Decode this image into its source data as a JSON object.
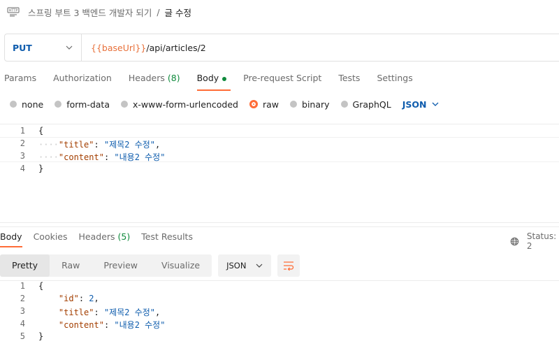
{
  "breadcrumb": {
    "path": "스프링 부트 3 백엔드 개발자 되기",
    "separator": "/",
    "current": "글 수정"
  },
  "request": {
    "method": "PUT",
    "url_var": "{{baseUrl}}",
    "url_path": "/api/articles/2"
  },
  "request_tabs": [
    {
      "label": "Params"
    },
    {
      "label": "Authorization"
    },
    {
      "label": "Headers",
      "count": "(8)"
    },
    {
      "label": "Body"
    },
    {
      "label": "Pre-request Script"
    },
    {
      "label": "Tests"
    },
    {
      "label": "Settings"
    }
  ],
  "body_types": [
    {
      "label": "none"
    },
    {
      "label": "form-data"
    },
    {
      "label": "x-www-form-urlencoded"
    },
    {
      "label": "raw",
      "selected": true
    },
    {
      "label": "binary"
    },
    {
      "label": "GraphQL"
    }
  ],
  "body_format": "JSON",
  "request_body": {
    "line_numbers": [
      "1",
      "2",
      "3",
      "4"
    ],
    "open": "{",
    "close": "}",
    "dots": "····",
    "title_key": "\"title\"",
    "title_value": "\"제목2 수정\"",
    "content_key": "\"content\"",
    "content_value": "\"내용2 수정\""
  },
  "response_tabs": [
    {
      "label": "Body"
    },
    {
      "label": "Cookies"
    },
    {
      "label": "Headers",
      "count": "(5)"
    },
    {
      "label": "Test Results"
    }
  ],
  "status_label": "Status: 2",
  "view_modes": [
    "Pretty",
    "Raw",
    "Preview",
    "Visualize"
  ],
  "response_format": "JSON",
  "response_body": {
    "line_numbers": [
      "1",
      "2",
      "3",
      "4",
      "5"
    ],
    "open": "{",
    "close": "}",
    "id_key": "\"id\"",
    "id_value": "2",
    "title_key": "\"title\"",
    "title_value": "\"제목2 수정\"",
    "content_key": "\"content\"",
    "content_value": "\"내용2 수정\""
  },
  "colors": {
    "accent": "#ff6c37",
    "method": "#0e5cad",
    "variable": "#e8703a",
    "count": "#0f8a3c"
  },
  "icons": [
    "http-request-icon",
    "chevron-down-icon",
    "globe-icon",
    "wrap-lines-icon"
  ]
}
